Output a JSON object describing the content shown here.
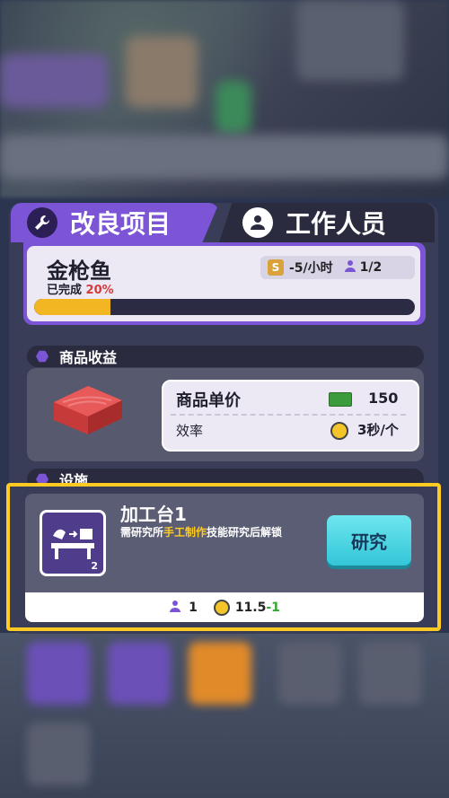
{
  "tabs": [
    {
      "label": "改良项目",
      "icon": "wrench-icon",
      "active": true
    },
    {
      "label": "工作人员",
      "icon": "person-icon",
      "active": false
    }
  ],
  "item": {
    "name": "金枪鱼",
    "done_label": "已完成",
    "done_pct": "20%",
    "progress_fraction": 0.2,
    "income_rate_icon": "S",
    "income_rate": "-5/小时",
    "workers": "1/2"
  },
  "income_section": {
    "title": "商品收益",
    "price_label": "商品单价",
    "price_value": "150",
    "efficiency_label": "效率",
    "efficiency_value": "3秒/个"
  },
  "equipment_section": {
    "title": "设施"
  },
  "station": {
    "name": "加工台1",
    "desc_prefix": "需研究所",
    "desc_highlight": "手工制作",
    "desc_suffix": "技能研究后解锁",
    "level": "2",
    "button_label": "研究",
    "worker_count": "1",
    "time_value": "11.5",
    "time_delta": "-1"
  },
  "colors": {
    "accent": "#7b55d6",
    "highlight": "#ffcb22",
    "progress": "#f3b623",
    "button": "#33c6d8"
  }
}
